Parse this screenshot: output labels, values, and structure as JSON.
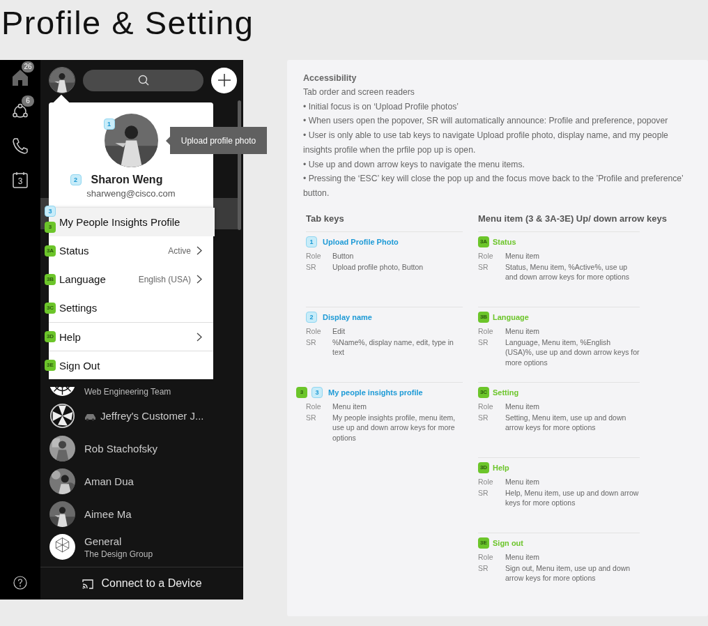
{
  "title": "Profile & Setting",
  "app": {
    "rail": [
      {
        "kind": "home",
        "badge": "26"
      },
      {
        "kind": "people",
        "badge": "6"
      },
      {
        "kind": "phone"
      },
      {
        "kind": "calendar",
        "label": "3"
      }
    ],
    "highlighted_row": true,
    "conversations": [
      {
        "subtitle": "Web Engineering Team",
        "kind": "team"
      },
      {
        "title": "Jeffrey's Customer J...",
        "kind": "car"
      },
      {
        "title": "Rob Stachofsky",
        "kind": "person"
      },
      {
        "title": "Aman Dua",
        "kind": "person"
      },
      {
        "title": "Aimee Ma",
        "kind": "person"
      },
      {
        "title": "General",
        "subtitle": "The Design Group",
        "kind": "logo"
      }
    ],
    "connect_button": "Connect to a Device",
    "popover": {
      "photo_badge": "1",
      "name_badge": "2",
      "name": "Sharon Weng",
      "email": "sharweng@cisco.com",
      "tooltip": "Upload profile photo",
      "menu": [
        {
          "label": "My People Insights Profile",
          "badges": [
            {
              "text": "3",
              "kind": "tab"
            },
            {
              "text": "3",
              "kind": "menu"
            }
          ],
          "selected": true,
          "chevron": false,
          "divider": false
        },
        {
          "label": "Status",
          "value": "Active",
          "badges": [
            {
              "text": "3A",
              "kind": "menu"
            }
          ],
          "selected": false,
          "chevron": true,
          "divider": false
        },
        {
          "label": "Language",
          "value": "English (USA)",
          "badges": [
            {
              "text": "3B",
              "kind": "menu"
            }
          ],
          "selected": false,
          "chevron": true,
          "divider": false
        },
        {
          "label": "Settings",
          "badges": [
            {
              "text": "3C",
              "kind": "menu"
            }
          ],
          "selected": false,
          "chevron": false,
          "divider": false
        },
        {
          "label": "Help",
          "badges": [
            {
              "text": "3D",
              "kind": "menu"
            }
          ],
          "selected": false,
          "chevron": true,
          "divider": true
        },
        {
          "label": "Sign Out",
          "badges": [
            {
              "text": "3E",
              "kind": "menu"
            }
          ],
          "selected": false,
          "chevron": false,
          "divider": true
        }
      ]
    }
  },
  "spec": {
    "heading": "Accessibility",
    "subheading": "Tab order and screen readers",
    "bullets": [
      "• Initial focus is on ‘Upload Profile photos’",
      "• When users open the popover, SR will automatically announce: Profile and preference, popover",
      "• User is only able to use tab keys to navigate Upload profile photo, display name, and my people insights profile when the prfile pop up is open.",
      "• Use up and down arrow keys to navigate the menu items.",
      "• Pressing the ‘ESC’ key will close the pop up and the focus move back to the ’Profile and preference’ button."
    ],
    "columns": [
      {
        "title": "Tab keys",
        "kind": "tab",
        "entries": [
          {
            "badges": [
              {
                "text": "1",
                "kind": "tab"
              }
            ],
            "title": "Upload Profile Photo",
            "role_label": "Role",
            "role": "Button",
            "sr_label": "SR",
            "sr": "Upload profile photo, Button"
          },
          {
            "badges": [
              {
                "text": "2",
                "kind": "tab"
              }
            ],
            "title": "Display name",
            "role_label": "Role",
            "role": "Edit",
            "sr_label": "SR",
            "sr": "%Name%, display name, edit, type in text"
          },
          {
            "badges": [
              {
                "text": "3",
                "kind": "menu"
              },
              {
                "text": "3",
                "kind": "tab"
              }
            ],
            "title": "My people insights profile",
            "role_label": "Role",
            "role": "Menu item",
            "sr_label": "SR",
            "sr": "My people insights profile, menu item, use up and down arrow keys for more options"
          }
        ]
      },
      {
        "title": "Menu item (3 & 3A-3E) Up/ down arrow keys",
        "kind": "menu",
        "entries": [
          {
            "badges": [
              {
                "text": "3A",
                "kind": "menu"
              }
            ],
            "title": "Status",
            "role_label": "Role",
            "role": "Menu item",
            "sr_label": "SR",
            "sr": "Status, Menu item, %Active%, use up and down arrow keys for more options"
          },
          {
            "badges": [
              {
                "text": "3B",
                "kind": "menu"
              }
            ],
            "title": "Language",
            "role_label": "Role",
            "role": "Menu item",
            "sr_label": "SR",
            "sr": "Language, Menu item, %English (USA)%, use up and down arrow keys for more options"
          },
          {
            "badges": [
              {
                "text": "3C",
                "kind": "menu"
              }
            ],
            "title": "Setting",
            "role_label": "Role",
            "role": "Menu item",
            "sr_label": "SR",
            "sr": "Setting, Menu item, use up and down arrow keys for more options"
          },
          {
            "badges": [
              {
                "text": "3D",
                "kind": "menu"
              }
            ],
            "title": "Help",
            "role_label": "Role",
            "role": "Menu item",
            "sr_label": "SR",
            "sr": "Help, Menu item, use up and down arrow keys for more options"
          },
          {
            "badges": [
              {
                "text": "3E",
                "kind": "menu"
              }
            ],
            "title": "Sign out",
            "role_label": "Role",
            "role": "Menu item",
            "sr_label": "SR",
            "sr": "Sign out, Menu item, use up and down arrow keys for more options"
          }
        ]
      }
    ]
  }
}
